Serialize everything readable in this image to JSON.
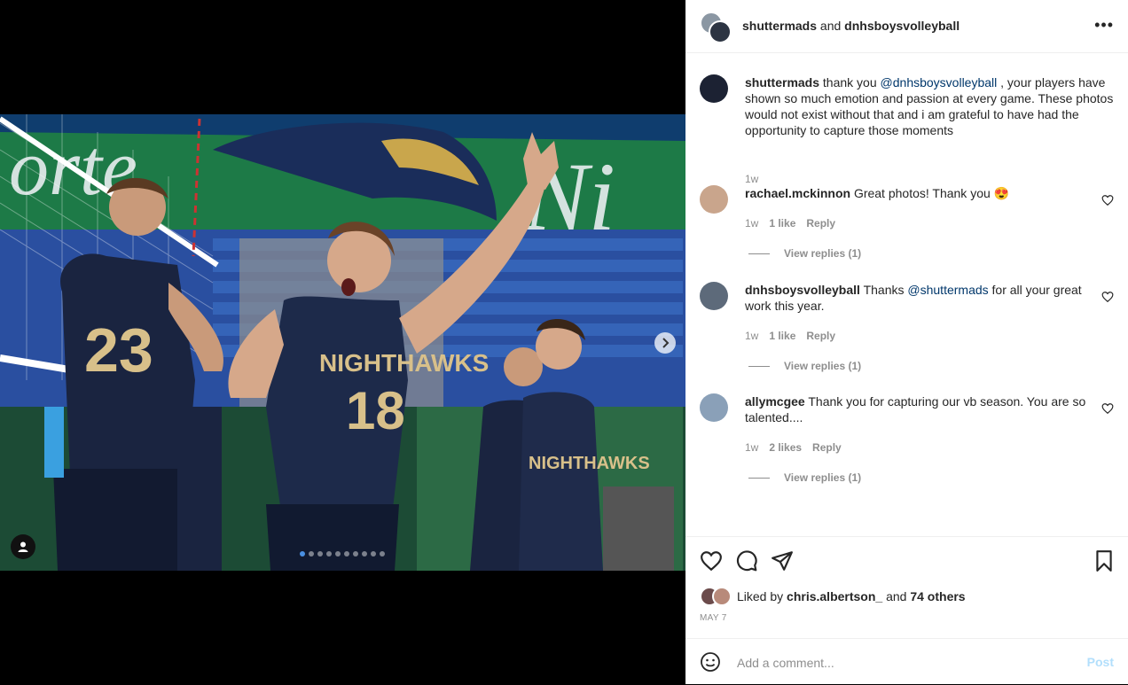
{
  "header": {
    "user1": "shuttermads",
    "connector": "and",
    "user2": "dnhsboysvolleyball"
  },
  "caption": {
    "user": "shuttermads",
    "text_before": "thank you",
    "mention": "@dnhsboysvolleyball",
    "text_after": ", your players have shown so much emotion and passion at every game. These photos would not exist without that and i am grateful to have had the opportunity to capture those moments",
    "time": "1w"
  },
  "comments": [
    {
      "user": "rachael.mckinnon",
      "text": "Great photos! Thank you 😍",
      "time": "1w",
      "likes": "1 like",
      "reply": "Reply",
      "view_replies": "View replies (1)",
      "avatar_color": "#c9a58c"
    },
    {
      "user": "dnhsboysvolleyball",
      "text_before": "Thanks",
      "mention": "@shuttermads",
      "text_after": "for all your great work this year.",
      "time": "1w",
      "likes": "1 like",
      "reply": "Reply",
      "view_replies": "View replies (1)",
      "avatar_color": "#5d6a7a"
    },
    {
      "user": "allymcgee",
      "text": "Thank you for capturing our vb season. You are so talented....",
      "time": "1w",
      "likes": "2 likes",
      "reply": "Reply",
      "view_replies": "View replies (1)",
      "avatar_color": "#8aa0b8"
    }
  ],
  "likes": {
    "prefix": "Liked by",
    "user": "chris.albertson_",
    "connector": "and",
    "others": "74 others"
  },
  "post_date": "MAY 7",
  "add_comment": {
    "placeholder": "Add a comment...",
    "post_label": "Post"
  },
  "carousel": {
    "count": 10,
    "active_index": 0
  },
  "colors": {
    "link": "#00376b",
    "post_disabled": "#b2dffc",
    "carousel_active": "#4a90e2"
  }
}
